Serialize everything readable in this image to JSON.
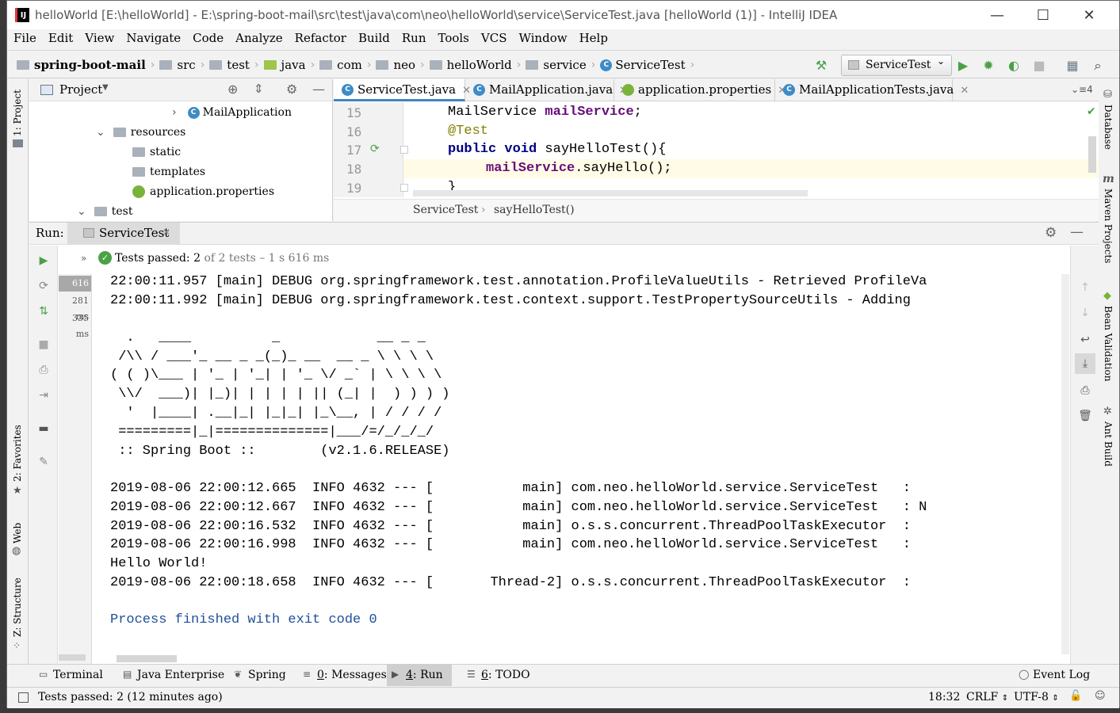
{
  "window": {
    "title": "helloWorld [E:\\helloWorld] - E:\\spring-boot-mail\\src\\test\\java\\com\\neo\\helloWorld\\service\\ServiceTest.java [helloWorld (1)] - IntelliJ IDEA",
    "controls": {
      "minimize": "—",
      "maximize": "☐",
      "close": "✕"
    }
  },
  "menu": [
    "File",
    "Edit",
    "View",
    "Navigate",
    "Code",
    "Analyze",
    "Refactor",
    "Build",
    "Run",
    "Tools",
    "VCS",
    "Window",
    "Help"
  ],
  "breadcrumb": [
    "spring-boot-mail",
    "src",
    "test",
    "java",
    "com",
    "neo",
    "helloWorld",
    "service",
    "ServiceTest"
  ],
  "run_config": "ServiceTest",
  "left_tools": [
    "1: Project",
    "2: Favorites",
    "Web",
    "Z: Structure"
  ],
  "right_tools": [
    "Database",
    "Maven Projects",
    "Bean Validation",
    "Ant Build"
  ],
  "project": {
    "title": "Project",
    "tree": [
      {
        "label": "MailApplication",
        "kind": "class"
      },
      {
        "label": "resources",
        "kind": "folder"
      },
      {
        "label": "static",
        "kind": "folder"
      },
      {
        "label": "templates",
        "kind": "folder"
      },
      {
        "label": "application.properties",
        "kind": "properties"
      },
      {
        "label": "test",
        "kind": "folder"
      }
    ]
  },
  "editor": {
    "tabs": [
      {
        "label": "ServiceTest.java",
        "active": true
      },
      {
        "label": "MailApplication.java",
        "active": false
      },
      {
        "label": "application.properties",
        "active": false
      },
      {
        "label": "MailApplicationTests.java",
        "active": false
      }
    ],
    "overflow": "4",
    "lines": [
      {
        "no": "15",
        "text": "MailService mailService;"
      },
      {
        "no": "16",
        "text": "@Test"
      },
      {
        "no": "17",
        "text": "public void sayHelloTest(){"
      },
      {
        "no": "18",
        "text": "mailService.sayHello();"
      },
      {
        "no": "19",
        "text": "}"
      }
    ],
    "crumbs": [
      "ServiceTest",
      "sayHelloTest()"
    ]
  },
  "run": {
    "label": "Run:",
    "tab": "ServiceTest",
    "status_bold": "Tests passed: 2",
    "status_rest": "of 2 tests – 1 s 616 ms",
    "times": [
      "616 ms",
      "281 ms",
      "335 ms"
    ],
    "console": [
      "22:00:11.957 [main] DEBUG org.springframework.test.annotation.ProfileValueUtils - Retrieved ProfileVa",
      "22:00:11.992 [main] DEBUG org.springframework.test.context.support.TestPropertySourceUtils - Adding",
      "",
      "  .   ____          _            __ _ _",
      " /\\\\ / ___'_ __ _ _(_)_ __  __ _ \\ \\ \\ \\",
      "( ( )\\___ | '_ | '_| | '_ \\/ _` | \\ \\ \\ \\",
      " \\\\/  ___)| |_)| | | | | || (_| |  ) ) ) )",
      "  '  |____| .__|_| |_|_| |_\\__, | / / / /",
      " =========|_|==============|___/=/_/_/_/",
      " :: Spring Boot ::        (v2.1.6.RELEASE)",
      "",
      "2019-08-06 22:00:12.665  INFO 4632 --- [           main] com.neo.helloWorld.service.ServiceTest   : ",
      "2019-08-06 22:00:12.667  INFO 4632 --- [           main] com.neo.helloWorld.service.ServiceTest   : N",
      "2019-08-06 22:00:16.532  INFO 4632 --- [           main] o.s.s.concurrent.ThreadPoolTaskExecutor  : ",
      "2019-08-06 22:00:16.998  INFO 4632 --- [           main] com.neo.helloWorld.service.ServiceTest   : ",
      "Hello World!",
      "2019-08-06 22:00:18.658  INFO 4632 --- [       Thread-2] o.s.s.concurrent.ThreadPoolTaskExecutor  : ",
      "",
      "Process finished with exit code 0"
    ]
  },
  "bottom_tabs": [
    {
      "key": "",
      "label": "Terminal",
      "active": false
    },
    {
      "key": "",
      "label": "Java Enterprise",
      "active": false
    },
    {
      "key": "",
      "label": "Spring",
      "active": false
    },
    {
      "key": "0",
      "label": ": Messages",
      "active": false
    },
    {
      "key": "4",
      "label": ": Run",
      "active": true
    },
    {
      "key": "6",
      "label": ": TODO",
      "active": false
    }
  ],
  "event_log": "Event Log",
  "status": {
    "message": "Tests passed: 2 (12 minutes ago)",
    "position": "18:32",
    "line_sep": "CRLF",
    "encoding": "UTF-8"
  },
  "colors": {
    "accent": "#4083c9",
    "passed": "#4aa146",
    "keyword": "#000080",
    "field": "#660e7a",
    "annotation": "#808000",
    "process": "#1f4f9a"
  }
}
